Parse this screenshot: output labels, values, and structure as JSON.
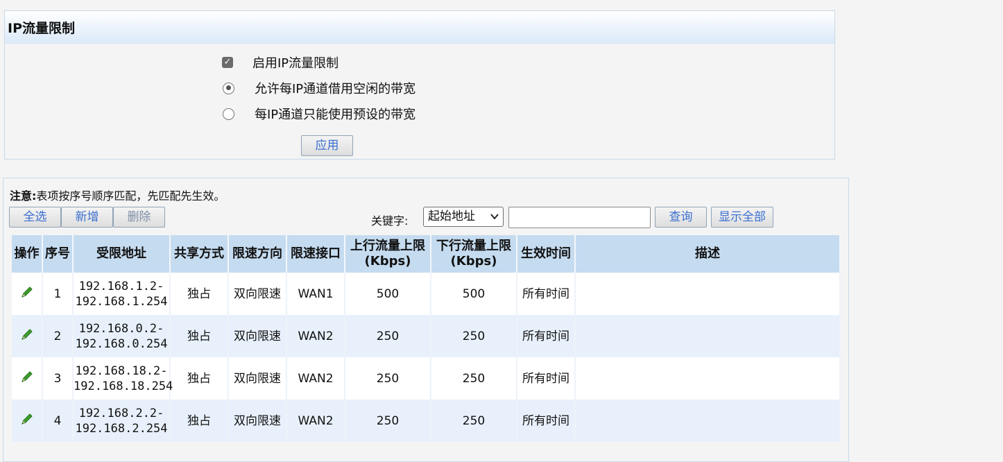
{
  "section": {
    "title": "IP流量限制",
    "enable_label": "启用IP流量限制",
    "enable_checked": true,
    "radio_options": [
      {
        "label": "允许每IP通道借用空闲的带宽",
        "selected": true
      },
      {
        "label": "每IP通道只能使用预设的带宽",
        "selected": false
      }
    ],
    "apply_label": "应用"
  },
  "list": {
    "note_prefix": "注意:",
    "note_text": "表项按序号顺序匹配，先匹配先生效。",
    "buttons": {
      "select_all": "全选",
      "add": "新增",
      "delete": "删除"
    },
    "keyword_label": "关键字:",
    "keyword_select_value": "起始地址",
    "search_input_value": "",
    "query_button": "查询",
    "show_all_button": "显示全部",
    "headers": {
      "op": "操作",
      "seq": "序号",
      "addr": "受限地址",
      "share": "共享方式",
      "dir": "限速方向",
      "iface": "限速接口",
      "up_line1": "上行流量上限",
      "up_line2": "(Kbps)",
      "down_line1": "下行流量上限",
      "down_line2": "(Kbps)",
      "time": "生效时间",
      "desc": "描述"
    },
    "rows": [
      {
        "seq": "1",
        "addr_start": "192.168.1.2-",
        "addr_end": "192.168.1.254",
        "share": "独占",
        "dir": "双向限速",
        "iface": "WAN1",
        "up": "500",
        "down": "500",
        "time": "所有时间",
        "desc": ""
      },
      {
        "seq": "2",
        "addr_start": "192.168.0.2-",
        "addr_end": "192.168.0.254",
        "share": "独占",
        "dir": "双向限速",
        "iface": "WAN2",
        "up": "250",
        "down": "250",
        "time": "所有时间",
        "desc": ""
      },
      {
        "seq": "3",
        "addr_start": "192.168.18.2-",
        "addr_end": "192.168.18.254",
        "share": "独占",
        "dir": "双向限速",
        "iface": "WAN2",
        "up": "250",
        "down": "250",
        "time": "所有时间",
        "desc": ""
      },
      {
        "seq": "4",
        "addr_start": "192.168.2.2-",
        "addr_end": "192.168.2.254",
        "share": "独占",
        "dir": "双向限速",
        "iface": "WAN2",
        "up": "250",
        "down": "250",
        "time": "所有时间",
        "desc": ""
      }
    ],
    "edit_icon": "pencil-icon",
    "colors": {
      "header_bg": "#c5dbf0",
      "alt_row_bg": "#e8f1fb",
      "button_text": "#3b6fd0"
    }
  }
}
